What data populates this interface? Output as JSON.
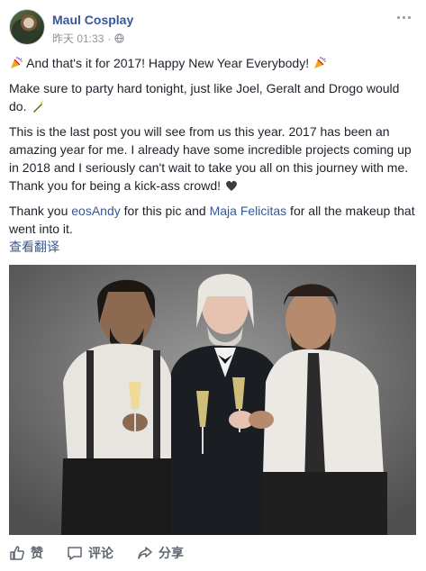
{
  "post": {
    "author": "Maul Cosplay",
    "time": "昨天 01:33",
    "paragraphs": {
      "p1": "And that's it for 2017! Happy New Year Everybody!",
      "p2": "Make sure to party hard tonight, just like Joel, Geralt and Drogo would do.",
      "p3": "This is the last post you will see from us this year. 2017 has been an amazing year for me. I already have some incredible projects coming up in 2018 and I seriously can't wait to take you all on this journey with me. Thank you for being a kick-ass crowd!",
      "p4_before": "Thank you ",
      "p4_link1": "eosAndy",
      "p4_mid": " for this pic and ",
      "p4_link2": "Maja Felicitas",
      "p4_after": " for all the makeup that went into it."
    },
    "translate": "查看翻译"
  },
  "actions": {
    "like": "赞",
    "comment": "评论",
    "share": "分享"
  },
  "icons": {
    "party": "party-popper-icon",
    "bottle": "champagne-bottle-icon",
    "heart": "black-heart-icon",
    "globe": "globe-icon",
    "more": "more-icon",
    "like": "thumbs-up-icon",
    "comment": "comment-icon",
    "share": "share-icon"
  },
  "colors": {
    "link": "#365899",
    "text": "#1d2129",
    "meta": "#90949c",
    "action": "#606770"
  }
}
